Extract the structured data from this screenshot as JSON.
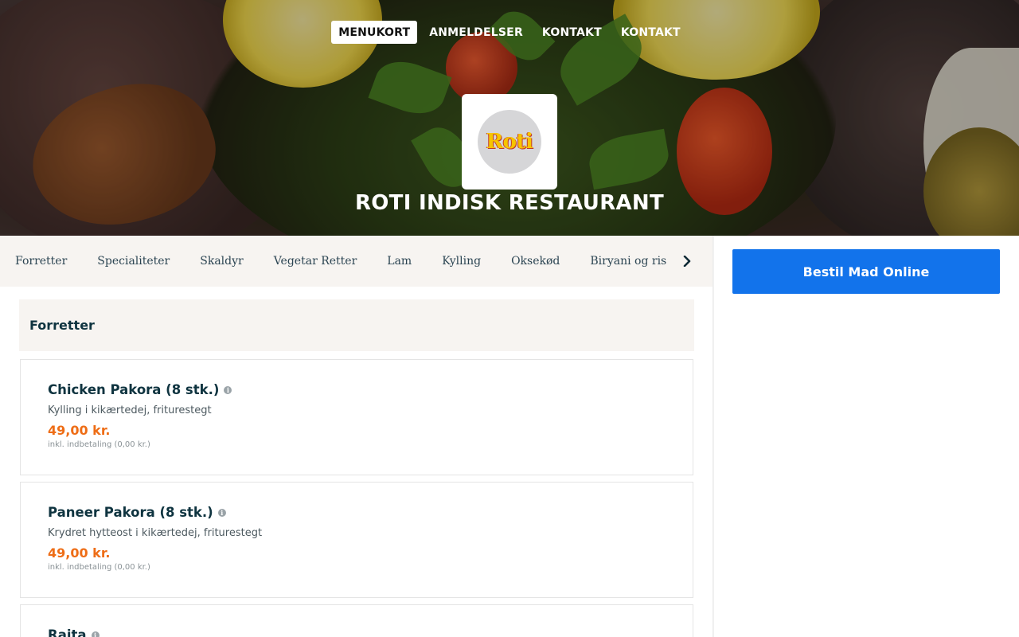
{
  "nav": {
    "items": [
      {
        "label": "MENUKORT",
        "active": true
      },
      {
        "label": "ANMELDELSER",
        "active": false
      },
      {
        "label": "KONTAKT",
        "active": false
      },
      {
        "label": "KONTAKT",
        "active": false
      }
    ]
  },
  "restaurant": {
    "logo_text": "Roti",
    "name": "ROTI INDISK RESTAURANT"
  },
  "categories": {
    "items": [
      "Forretter",
      "Specialiteter",
      "Skaldyr",
      "Vegetar Retter",
      "Lam",
      "Kylling",
      "Oksekød",
      "Biryani og ris"
    ],
    "next_icon": "chevron-right-icon"
  },
  "order": {
    "button_label": "Bestil Mad Online",
    "button_color": "#1273eb"
  },
  "menu": {
    "section_title": "Forretter",
    "items": [
      {
        "name": "Chicken Pakora (8 stk.)",
        "description": "Kylling i kikærtedej, friturestegt",
        "price": "49,00 kr.",
        "fee": "inkl. indbetaling (0,00 kr.)"
      },
      {
        "name": "Paneer Pakora (8 stk.)",
        "description": "Krydret hytteost i kikærtedej, friturestegt",
        "price": "49,00 kr.",
        "fee": "inkl. indbetaling (0,00 kr.)"
      },
      {
        "name": "Raita",
        "description": "",
        "price": "",
        "fee": ""
      }
    ]
  },
  "colors": {
    "accent_price": "#ee6d16",
    "heading": "#0f3440",
    "category_bar": "#f7f4f1"
  }
}
